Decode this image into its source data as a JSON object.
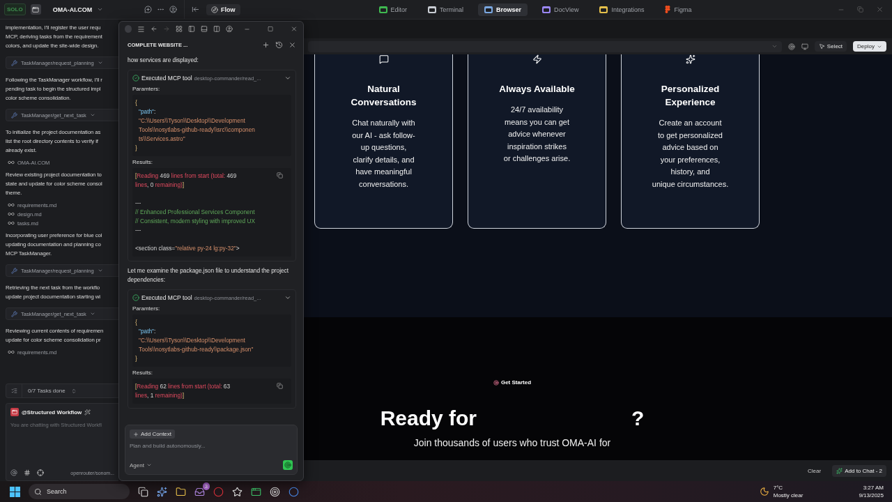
{
  "topbar": {
    "logo": "SOLO",
    "project": "OMA-AI.COM",
    "flow": "Flow",
    "tabs": [
      {
        "label": "Editor",
        "selected": false,
        "color": "#3fb950"
      },
      {
        "label": "Terminal",
        "selected": false,
        "color": "#c9cdd4"
      },
      {
        "label": "Browser",
        "selected": true,
        "color": "#7aa7e0"
      },
      {
        "label": "DocView",
        "selected": false,
        "color": "#9b87f5"
      },
      {
        "label": "Integrations",
        "selected": false,
        "color": "#e5c04b"
      },
      {
        "label": "Figma",
        "selected": false,
        "color": "#f24e1e"
      }
    ]
  },
  "chat": {
    "items": [
      {
        "kind": "paragraph",
        "lines": [
          "implementation, I'll register the user requ",
          "MCP, deriving tasks from the requirement",
          "colors, and update the site-wide design."
        ]
      },
      {
        "kind": "tool",
        "text": "TaskManager/request_planning"
      },
      {
        "kind": "paragraph",
        "lines": [
          "Following the TaskManager workflow, I'll r",
          "pending task to begin the structured impl",
          "color scheme consolidation."
        ]
      },
      {
        "kind": "tool",
        "text": "TaskManager/get_next_task"
      },
      {
        "kind": "paragraph",
        "lines": [
          "To initialize the project documentation as",
          "list the root directory contents to verify if",
          "already exist."
        ]
      },
      {
        "kind": "file",
        "text": "OMA-AI.COM"
      },
      {
        "kind": "paragraph",
        "lines": [
          "Review existing project documentation to",
          "state and update for color scheme consol",
          "theme."
        ]
      },
      {
        "kind": "file",
        "text": "requirements.md"
      },
      {
        "kind": "file",
        "text": "design.md"
      },
      {
        "kind": "file",
        "text": "tasks.md"
      },
      {
        "kind": "paragraph",
        "lines": [
          "Incorporating user preference for blue col",
          "updating documentation and planning co",
          "MCP TaskManager."
        ]
      },
      {
        "kind": "tool",
        "text": "TaskManager/request_planning"
      },
      {
        "kind": "paragraph",
        "lines": [
          "Retrieving the next task from the workflo",
          "update project documentation starting wi"
        ]
      },
      {
        "kind": "tool",
        "text": "TaskManager/get_next_task"
      },
      {
        "kind": "paragraph",
        "lines": [
          "Reviewing current contents of requiremen",
          "update for color scheme consolidation pr"
        ]
      },
      {
        "kind": "file",
        "text": "requirements.md"
      }
    ],
    "tasks": "0/7 Tasks done",
    "agent": "@Structured Workflow",
    "placeholder": "You are chatting with Structured Workfl",
    "model": "openrouter/sonom..."
  },
  "panel": {
    "title": "COMPLETE WEBSITE ...",
    "items": [
      {
        "kind": "text",
        "text": "how services are displayed:"
      },
      {
        "kind": "tool",
        "title": "Executed MCP tool",
        "tool": "desktop-commander/read_...",
        "params_label": "Paramters:",
        "results_label": "Results:",
        "params": [
          {
            "tokens": [
              {
                "kind": "brace",
                "text": "{"
              }
            ]
          },
          {
            "indent": true,
            "tokens": [
              {
                "kind": "key",
                "text": "\"path\""
              },
              {
                "kind": "plain",
                "text": ":"
              }
            ]
          },
          {
            "indent": true,
            "tokens": [
              {
                "kind": "string",
                "text": "\"C:\\\\Users\\\\Tyson\\\\Desktop\\\\Development"
              }
            ]
          },
          {
            "indent": true,
            "tokens": [
              {
                "kind": "string",
                "text": "Tools\\\\nosytlabs-github-ready\\\\src\\\\componen"
              }
            ]
          },
          {
            "indent": true,
            "tokens": [
              {
                "kind": "string",
                "text": "ts\\\\Services.astro\""
              }
            ]
          },
          {
            "tokens": [
              {
                "kind": "brace",
                "text": "}"
              }
            ]
          }
        ],
        "results": [
          {
            "tokens": [
              {
                "kind": "bracket",
                "text": "["
              },
              {
                "kind": "red",
                "text": "Reading"
              },
              {
                "kind": "plain",
                "text": " 469 "
              },
              {
                "kind": "red",
                "text": "lines from start (total:"
              },
              {
                "kind": "plain",
                "text": " 469"
              }
            ]
          },
          {
            "tokens": [
              {
                "kind": "red",
                "text": "lines"
              },
              {
                "kind": "plain",
                "text": ", 0 "
              },
              {
                "kind": "red",
                "text": "remaining)"
              },
              {
                "kind": "bracket",
                "text": "]"
              }
            ]
          },
          {
            "gap_before": true,
            "tokens": [
              {
                "kind": "plain",
                "text": "---"
              }
            ]
          },
          {
            "tokens": [
              {
                "kind": "comment",
                "text": "// Enhanced Professional Services Component"
              }
            ]
          },
          {
            "tokens": [
              {
                "kind": "comment",
                "text": "// Consistent, modern styling with improved UX"
              }
            ]
          },
          {
            "tokens": [
              {
                "kind": "plain",
                "text": "---"
              }
            ]
          },
          {
            "gap_before": true,
            "tokens": [
              {
                "kind": "plain",
                "text": "<section class="
              },
              {
                "kind": "string",
                "text": "\"relative py-24 lg:py-32\""
              },
              {
                "kind": "plain",
                "text": ">"
              }
            ]
          }
        ]
      },
      {
        "kind": "text",
        "text": "Let me examine the package.json file to understand the project dependencies:"
      },
      {
        "kind": "tool",
        "title": "Executed MCP tool",
        "tool": "desktop-commander/read_...",
        "params_label": "Paramters:",
        "results_label": "Results:",
        "params": [
          {
            "tokens": [
              {
                "kind": "brace",
                "text": "{"
              }
            ]
          },
          {
            "indent": true,
            "tokens": [
              {
                "kind": "key",
                "text": "\"path\""
              },
              {
                "kind": "plain",
                "text": ":"
              }
            ]
          },
          {
            "indent": true,
            "tokens": [
              {
                "kind": "string",
                "text": "\"C:\\\\Users\\\\Tyson\\\\Desktop\\\\Development"
              }
            ]
          },
          {
            "indent": true,
            "tokens": [
              {
                "kind": "string",
                "text": "Tools\\\\nosytlabs-github-ready\\\\package.json\""
              }
            ]
          },
          {
            "tokens": [
              {
                "kind": "brace",
                "text": "}"
              }
            ]
          }
        ],
        "results": [
          {
            "tokens": [
              {
                "kind": "bracket",
                "text": "["
              },
              {
                "kind": "red",
                "text": "Reading"
              },
              {
                "kind": "plain",
                "text": " 62 "
              },
              {
                "kind": "red",
                "text": "lines from start (total:"
              },
              {
                "kind": "plain",
                "text": " 63"
              }
            ]
          },
          {
            "tokens": [
              {
                "kind": "red",
                "text": "lines"
              },
              {
                "kind": "plain",
                "text": ", 1 "
              },
              {
                "kind": "red",
                "text": "remaining)"
              },
              {
                "kind": "bracket",
                "text": "]"
              }
            ]
          }
        ]
      }
    ],
    "add_context": "Add Context",
    "placeholder": "Plan and build autonomously...",
    "mode": "Agent"
  },
  "browser": {
    "select": "Select",
    "deploy": "Deploy",
    "cards": [
      {
        "title": [
          "Natural",
          "Conversations"
        ],
        "lines": [
          "Chat naturally with",
          "our AI - ask follow-",
          "up questions,",
          "clarify details, and",
          "have meaningful",
          "conversations."
        ]
      },
      {
        "title": [
          "Always Available"
        ],
        "lines": [
          "24/7 availability",
          "means you can get",
          "advice whenever",
          "inspiration strikes",
          "or challenges arise."
        ]
      },
      {
        "title": [
          "Personalized",
          "Experience"
        ],
        "lines": [
          "Create an account",
          "to get personalized",
          "advice based on",
          "your preferences,",
          "history, and",
          "unique circumstances."
        ]
      }
    ],
    "badge": "Get Started",
    "heading_start": "Ready for",
    "heading_end": "?",
    "subtitle": "Join thousands of users who trust OMA-AI for",
    "clear": "Clear",
    "add_to_chat": "Add to Chat - 2"
  },
  "taskbar": {
    "search": "Search",
    "badge": "3",
    "temperature": "7°C",
    "weather": "Mostly clear",
    "time": "3:27 AM",
    "date": "9/13/2025"
  }
}
